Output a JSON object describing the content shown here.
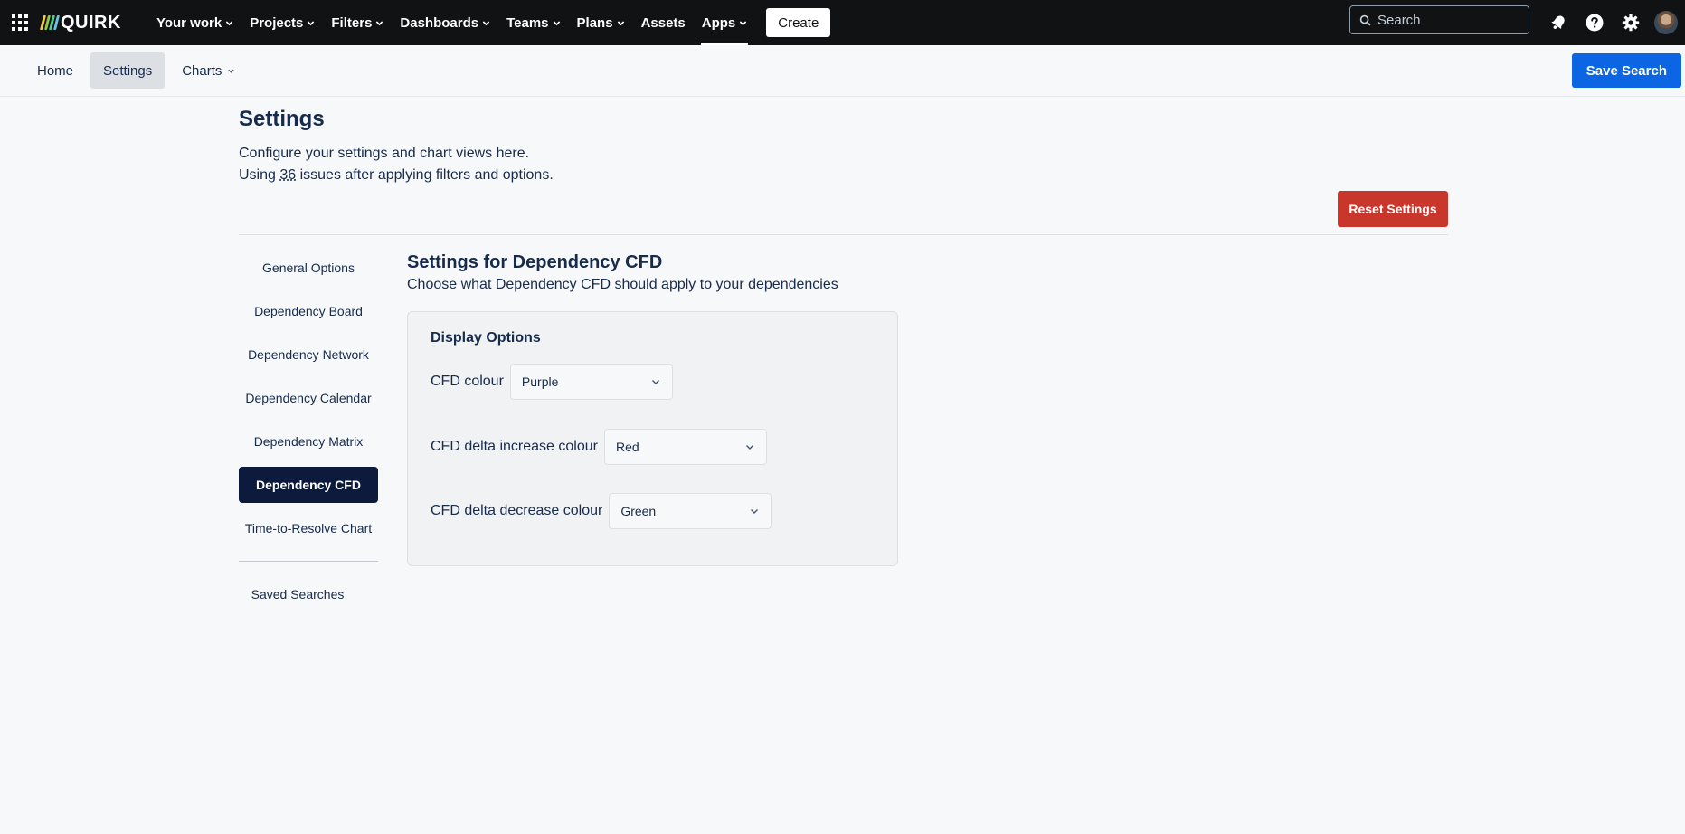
{
  "brand": {
    "name": "QUIRK",
    "bar_colors": [
      "#f5cd47",
      "#94c748",
      "#4bce97",
      "#6cc3e0"
    ]
  },
  "topnav": {
    "items": [
      {
        "label": "Your work",
        "dropdown": true
      },
      {
        "label": "Projects",
        "dropdown": true
      },
      {
        "label": "Filters",
        "dropdown": true
      },
      {
        "label": "Dashboards",
        "dropdown": true
      },
      {
        "label": "Teams",
        "dropdown": true
      },
      {
        "label": "Plans",
        "dropdown": true
      },
      {
        "label": "Assets",
        "dropdown": false
      },
      {
        "label": "Apps",
        "dropdown": true,
        "active": true
      }
    ],
    "create_label": "Create",
    "search_placeholder": "Search"
  },
  "subnav": {
    "tabs": [
      {
        "label": "Home"
      },
      {
        "label": "Settings",
        "selected": true
      },
      {
        "label": "Charts",
        "dropdown": true
      }
    ],
    "save_search_label": "Save Search"
  },
  "page": {
    "title": "Settings",
    "description": "Configure your settings and chart views here.",
    "issues_prefix": "Using ",
    "issues_count": "36",
    "issues_suffix": " issues after applying filters and options.",
    "reset_label": "Reset Settings"
  },
  "sidemenu": {
    "items": [
      {
        "label": "General Options"
      },
      {
        "label": "Dependency Board"
      },
      {
        "label": "Dependency Network"
      },
      {
        "label": "Dependency Calendar"
      },
      {
        "label": "Dependency Matrix"
      },
      {
        "label": "Dependency CFD",
        "active": true
      },
      {
        "label": "Time-to-Resolve Chart"
      }
    ],
    "saved_searches_label": "Saved Searches"
  },
  "content": {
    "title": "Settings for Dependency CFD",
    "description": "Choose what Dependency CFD should apply to your dependencies",
    "panel_title": "Display Options",
    "fields": [
      {
        "label": "CFD colour",
        "value": "Purple"
      },
      {
        "label": "CFD delta increase colour",
        "value": "Red"
      },
      {
        "label": "CFD delta decrease colour",
        "value": "Green"
      }
    ]
  },
  "colors": {
    "topbar": "#101214",
    "primary": "#0c66e4",
    "danger": "#c9372c",
    "active_menu": "#0c1a3d"
  }
}
